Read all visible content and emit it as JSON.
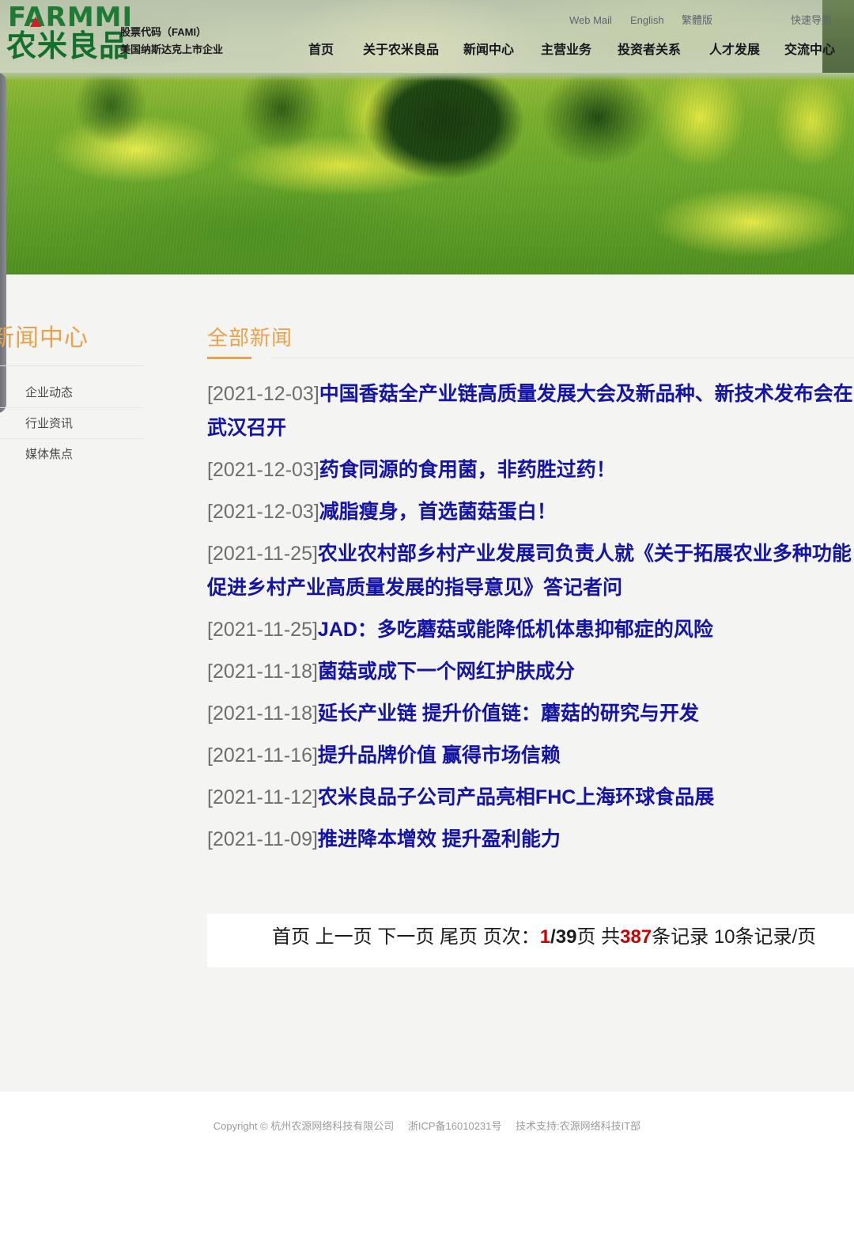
{
  "brand": {
    "logo_text": "FARMMI",
    "logo_text_cn": "农米良品",
    "stock_label": "股票代码（FAMI）",
    "listing_label": "美国纳斯达克上市企业"
  },
  "utility": {
    "webmail": "Web Mail",
    "english": "English",
    "traditional": "繁體版",
    "quick_nav": "快速导航"
  },
  "nav": {
    "items": [
      {
        "label": "首页"
      },
      {
        "label": "关于农米良品"
      },
      {
        "label": "新闻中心"
      },
      {
        "label": "主营业务"
      },
      {
        "label": "投资者关系"
      },
      {
        "label": "人才发展"
      },
      {
        "label": "交流中心"
      }
    ]
  },
  "sidebar": {
    "title": "新闻中心",
    "items": [
      {
        "label": "企业动态"
      },
      {
        "label": "行业资讯"
      },
      {
        "label": "媒体焦点"
      }
    ]
  },
  "main": {
    "title": "全部新闻",
    "news": [
      {
        "date": "[2021-12-03]",
        "title": "中国香菇全产业链高质量发展大会及新品种、新技术发布会在武汉召开"
      },
      {
        "date": "[2021-12-03]",
        "title": "药食同源的食用菌，非药胜过药！"
      },
      {
        "date": "[2021-12-03]",
        "title": "减脂瘦身，首选菌菇蛋白！"
      },
      {
        "date": "[2021-11-25]",
        "title": "农业农村部乡村产业发展司负责人就《关于拓展农业多种功能 促进乡村产业高质量发展的指导意见》答记者问"
      },
      {
        "date": "[2021-11-25]",
        "title": "JAD：多吃蘑菇或能降低机体患抑郁症的风险"
      },
      {
        "date": "[2021-11-18]",
        "title": "菌菇或成下一个网红护肤成分"
      },
      {
        "date": "[2021-11-18]",
        "title": "延长产业链 提升价值链：蘑菇的研究与开发"
      },
      {
        "date": "[2021-11-16]",
        "title": "提升品牌价值 赢得市场信赖"
      },
      {
        "date": "[2021-11-12]",
        "title": "农米良品子公司产品亮相FHC上海环球食品展"
      },
      {
        "date": "[2021-11-09]",
        "title": "推进降本增效 提升盈利能力"
      }
    ]
  },
  "pagination": {
    "first": "首页",
    "prev": "上一页",
    "next": "下一页",
    "last": "尾页",
    "page_label": "页次：",
    "current_page": "1",
    "page_sep": "/",
    "total_pages": "39",
    "page_unit": "页",
    "total_prefix": "共",
    "total_records": "387",
    "total_suffix": "条记录",
    "per_page": "10",
    "per_page_suffix": "条记录/页"
  },
  "footer": {
    "copyright": "Copyright © 杭州农源网络科技有限公司",
    "icp": "浙ICP备16010231号",
    "support": "技术支持:农源网络科技IT部"
  },
  "colors": {
    "accent_orange": "#e8a24c",
    "link_blue": "#1414a8",
    "highlight_red": "#cc0000",
    "brand_green": "#12702c",
    "page_bg": "#f4f4f2"
  }
}
